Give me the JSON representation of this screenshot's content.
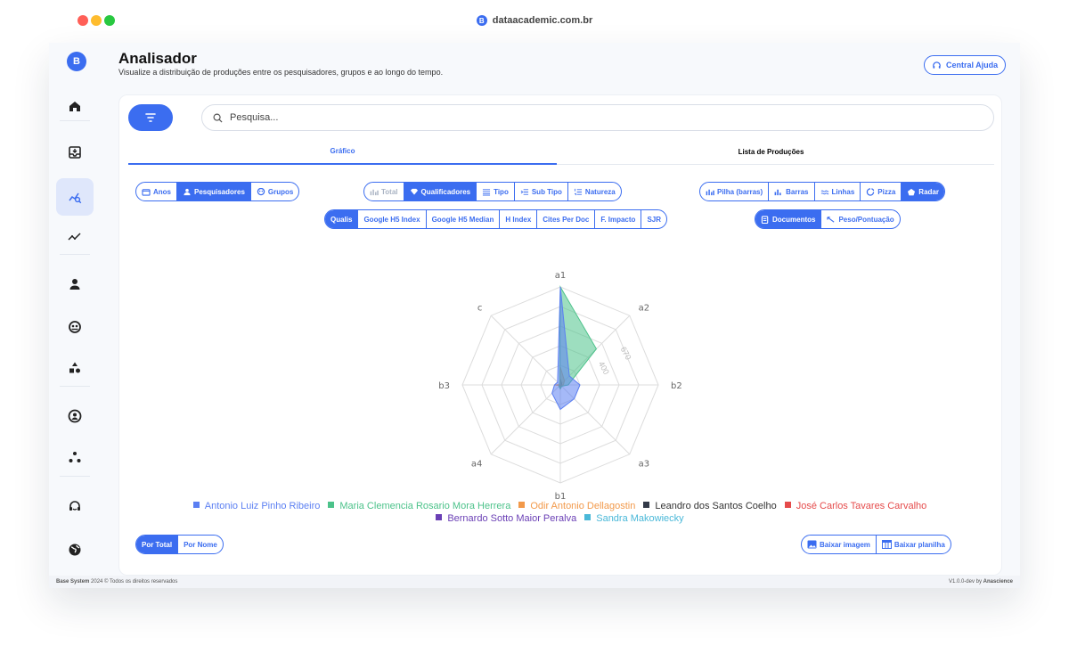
{
  "browser": {
    "url": "dataacademic.com.br",
    "favicon": "B"
  },
  "app": {
    "logo": "B",
    "title": "Analisador",
    "subtitle": "Visualize a distribuição de produções entre os pesquisadores, grupos e ao longo do tempo.",
    "help_label": "Central Ajuda"
  },
  "sidebar": {
    "items": [
      {
        "icon": "home-icon",
        "active": false
      },
      {
        "icon": "inbox-icon",
        "active": false
      },
      {
        "icon": "analytics-icon",
        "active": true
      },
      {
        "icon": "trend-icon",
        "active": false
      },
      {
        "icon": "user-icon",
        "active": false
      },
      {
        "icon": "groups-icon",
        "active": false
      },
      {
        "icon": "shapes-icon",
        "active": false
      },
      {
        "icon": "account-icon",
        "active": false
      },
      {
        "icon": "network-icon",
        "active": false
      },
      {
        "icon": "support-icon",
        "active": false
      },
      {
        "icon": "globe-icon",
        "active": false
      }
    ]
  },
  "search": {
    "placeholder": "Pesquisa..."
  },
  "tabs": [
    {
      "label": "Gráfico",
      "active": true
    },
    {
      "label": "Lista de Produções",
      "active": false
    }
  ],
  "group_by": [
    {
      "label": "Anos"
    },
    {
      "label": "Pesquisadores",
      "active": true
    },
    {
      "label": "Grupos"
    }
  ],
  "metric_type": [
    {
      "label": "Total",
      "disabled": true
    },
    {
      "label": "Qualificadores",
      "active": true
    },
    {
      "label": "Tipo"
    },
    {
      "label": "Sub Tipo"
    },
    {
      "label": "Natureza"
    }
  ],
  "chart_types": [
    {
      "label": "Pilha (barras)"
    },
    {
      "label": "Barras"
    },
    {
      "label": "Linhas"
    },
    {
      "label": "Pizza"
    },
    {
      "label": "Radar",
      "active": true
    }
  ],
  "qualifiers": [
    {
      "label": "Qualis",
      "active": true
    },
    {
      "label": "Google H5 Index"
    },
    {
      "label": "Google H5 Median"
    },
    {
      "label": "H Index"
    },
    {
      "label": "Cites Per Doc"
    },
    {
      "label": "F. Impacto"
    },
    {
      "label": "SJR"
    }
  ],
  "value_mode": [
    {
      "label": "Documentos",
      "active": true
    },
    {
      "label": "Peso/Pontuação"
    }
  ],
  "sort_mode": [
    {
      "label": "Por Total",
      "active": true
    },
    {
      "label": "Por Nome"
    }
  ],
  "downloads": {
    "image": "Baixar imagem",
    "sheet": "Baixar planilha"
  },
  "footer": {
    "left_bold": "Base System",
    "left": "2024 © Todos os direitos reservados",
    "right": "V1.0.0-dev by",
    "right_bold": "Anascience"
  },
  "chart_data": {
    "type": "radar",
    "categories": [
      "a1",
      "a2",
      "b2",
      "a3",
      "b1",
      "a4",
      "b3",
      "c"
    ],
    "rmax": 1000,
    "tick_labels": [
      "400",
      "670"
    ],
    "series": [
      {
        "name": "Antonio Luiz Pinho Ribeiro",
        "color": "#5b7ff2",
        "values": [
          1000,
          130,
          200,
          200,
          250,
          120,
          60,
          40
        ]
      },
      {
        "name": "Maria Clemencia Rosario Mora Herrera",
        "color": "#4cc28a",
        "values": [
          1000,
          520,
          80,
          20,
          40,
          20,
          10,
          10
        ]
      },
      {
        "name": "Odir Antonio Dellagostin",
        "color": "#f2994a",
        "values": [
          180,
          60,
          30,
          20,
          40,
          10,
          60,
          5
        ]
      },
      {
        "name": "Leandro dos Santos Coelho",
        "color": "#333a48",
        "values": [
          60,
          20,
          10,
          10,
          15,
          5,
          10,
          5
        ]
      },
      {
        "name": "José Carlos Tavares Carvalho",
        "color": "#e54b4b",
        "values": [
          40,
          15,
          20,
          10,
          30,
          10,
          30,
          5
        ]
      },
      {
        "name": "Bernardo Sotto Maior Peralva",
        "color": "#6a3fb5",
        "values": [
          30,
          10,
          5,
          5,
          10,
          5,
          10,
          2
        ]
      },
      {
        "name": "Sandra Makowiecky",
        "color": "#4ab8d8",
        "values": [
          20,
          10,
          5,
          5,
          8,
          5,
          5,
          2
        ]
      }
    ]
  }
}
